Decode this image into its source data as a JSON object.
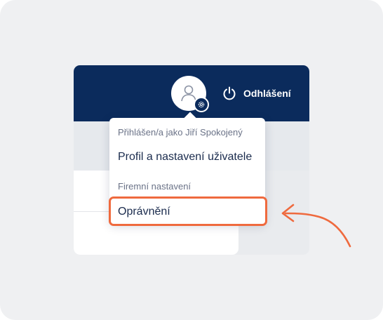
{
  "header": {
    "logout_label": "Odhlášení"
  },
  "user_menu": {
    "logged_in_label": "Přihlášen/a jako Jiří Spokojený",
    "profile_item": "Profil a nastavení uživatele",
    "company_section_label": "Firemní nastavení",
    "permissions_item": "Oprávnění"
  },
  "colors": {
    "topbar": "#0b2b5c",
    "highlight": "#ef6a3e",
    "canvas": "#eff0f2"
  },
  "icons": [
    "user-icon",
    "gear-icon",
    "power-icon",
    "pointer-arrow-icon"
  ]
}
